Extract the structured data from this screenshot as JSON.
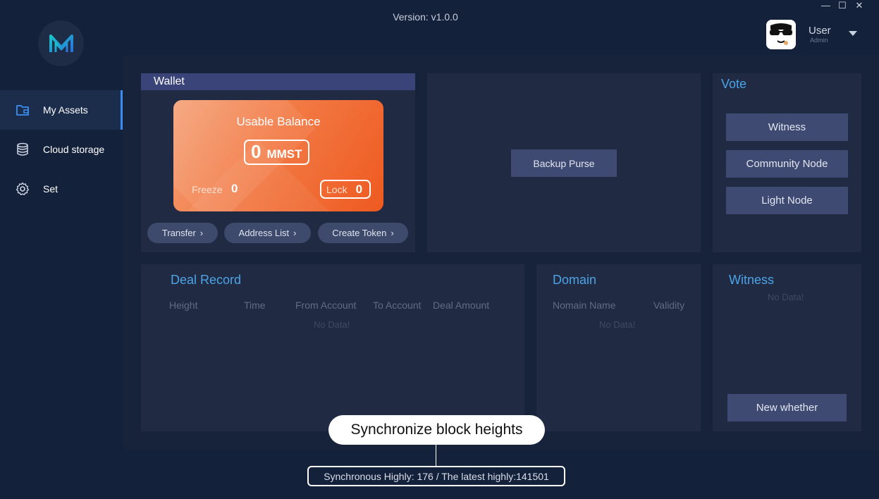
{
  "window": {
    "version_label": "Version:  v1.0.0"
  },
  "user": {
    "name": "User",
    "role": "Admin"
  },
  "sidebar": {
    "items": [
      {
        "label": "My Assets",
        "icon": "wallet-icon",
        "active": true
      },
      {
        "label": "Cloud storage",
        "icon": "database-icon",
        "active": false
      },
      {
        "label": "Set",
        "icon": "gear-icon",
        "active": false
      }
    ]
  },
  "wallet": {
    "header": "Wallet",
    "usable_label": "Usable Balance",
    "balance": "0",
    "unit": "MMST",
    "freeze_label": "Freeze",
    "freeze_value": "0",
    "lock_label": "Lock",
    "lock_value": "0",
    "actions": [
      "Transfer",
      "Address List",
      "Create Token"
    ]
  },
  "backup": {
    "button": "Backup Purse"
  },
  "vote": {
    "title": "Vote",
    "buttons": [
      "Witness",
      "Community Node",
      "Light Node"
    ]
  },
  "deal_record": {
    "title": "Deal Record",
    "columns": [
      "Height",
      "Time",
      "From Account",
      "To Account",
      "Deal Amount"
    ],
    "empty": "No Data!"
  },
  "domain": {
    "title": "Domain",
    "columns": [
      "Nomain Name",
      "Validity"
    ],
    "empty": "No Data!"
  },
  "witness": {
    "title": "Witness",
    "empty": "No Data!",
    "button": "New whether"
  },
  "sync": {
    "tooltip": "Synchronize block heights",
    "status": "Synchronous Highly: 176 / The latest highly:141501"
  },
  "colors": {
    "background": "#14213a",
    "panel": "#202b43",
    "accent": "#4ca3e6",
    "active_indicator": "#3b8ef0",
    "balance_card": "#f27a45"
  }
}
